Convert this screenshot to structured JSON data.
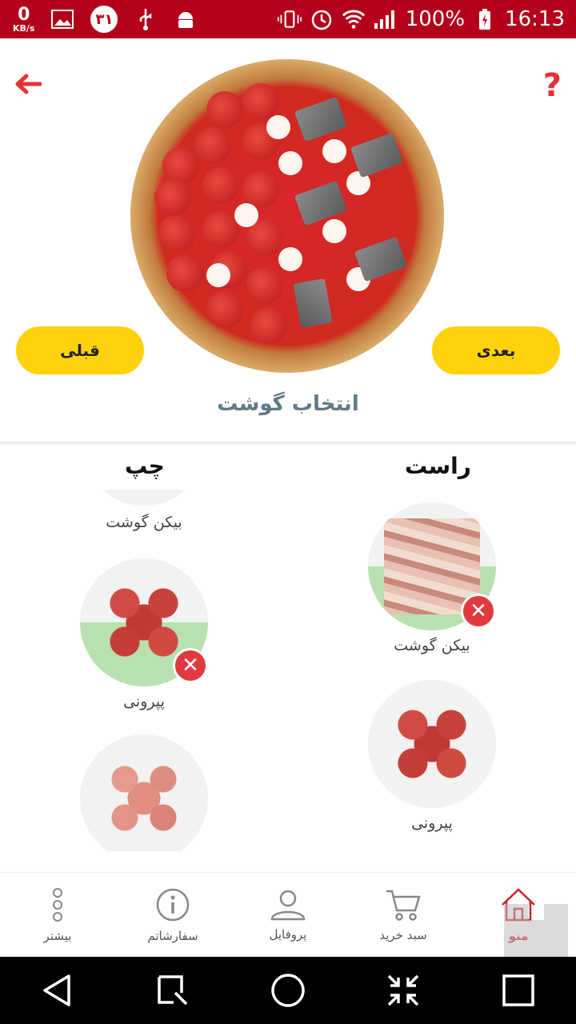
{
  "status_bar": {
    "net_speed_value": "0",
    "net_speed_unit": "KB/s",
    "date_badge": "۳۱",
    "battery": "100%",
    "time": "16:13"
  },
  "header": {
    "back_icon": "arrow-left-icon",
    "help_label": "?",
    "prev_label": "قبلی",
    "next_label": "بعدی",
    "section_title": "انتخاب گوشت"
  },
  "columns": {
    "left_title": "چپ",
    "right_title": "راست"
  },
  "left_items": {
    "partial_label": "بیکن گوشت",
    "pepperoni_label": "پپرونی"
  },
  "right_items": {
    "bacon_label": "بیکن گوشت",
    "pepperoni_label": "پپرونی"
  },
  "remove_symbol": "✕",
  "bottom_nav": {
    "more": "بیشتر",
    "orders": "سفارشاتم",
    "profile": "پروفایل",
    "cart": "سبد خرید",
    "menu": "منو"
  },
  "colors": {
    "accent_red": "#b5001b",
    "button_yellow": "#ffd20c",
    "selected_green": "#b8e0b0",
    "remove_red": "#e03a3e"
  }
}
